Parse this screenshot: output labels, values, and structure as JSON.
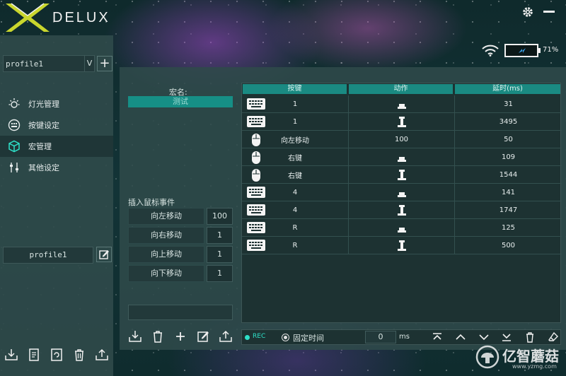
{
  "brand": {
    "logo_text": "DELUX"
  },
  "status": {
    "battery_percent": "71%",
    "battery_level": 0.71
  },
  "sidebar": {
    "profile_select_value": "profile1",
    "profile_select_arrow": "V",
    "items": [
      {
        "label": "灯光管理",
        "icon": "sun-icon",
        "active": false
      },
      {
        "label": "按键设定",
        "icon": "keypad-icon",
        "active": false
      },
      {
        "label": "宏管理",
        "icon": "cube-icon",
        "active": true
      },
      {
        "label": "其他设定",
        "icon": "sliders-icon",
        "active": false
      }
    ],
    "profile_name": "profile1"
  },
  "macro": {
    "name_label": "宏名:",
    "name_value": "测试",
    "insert_title": "插入鼠标事件",
    "moves": [
      {
        "label": "向左移动",
        "value": "100"
      },
      {
        "label": "向右移动",
        "value": "1"
      },
      {
        "label": "向上移动",
        "value": "1"
      },
      {
        "label": "向下移动",
        "value": "1"
      }
    ]
  },
  "table": {
    "headers": [
      "按键",
      "动作",
      "延时(ms)"
    ],
    "rows": [
      {
        "device": "keyboard",
        "key": "1",
        "action": "press",
        "delay": "31"
      },
      {
        "device": "keyboard",
        "key": "1",
        "action": "release",
        "delay": "3495"
      },
      {
        "device": "mouse",
        "key": "向左移动",
        "action": "100",
        "delay": "50"
      },
      {
        "device": "mouse",
        "key": "右键",
        "action": "press",
        "delay": "109"
      },
      {
        "device": "mouse",
        "key": "右键",
        "action": "release",
        "delay": "1544"
      },
      {
        "device": "keyboard",
        "key": "4",
        "action": "press",
        "delay": "141"
      },
      {
        "device": "keyboard",
        "key": "4",
        "action": "release",
        "delay": "1747"
      },
      {
        "device": "keyboard",
        "key": "R",
        "action": "press",
        "delay": "125"
      },
      {
        "device": "keyboard",
        "key": "R",
        "action": "release",
        "delay": "500"
      }
    ]
  },
  "recording": {
    "rec_label": "REC",
    "fixed_time_label": "固定时间",
    "ms_value": "0",
    "ms_unit": "ms"
  },
  "watermark": {
    "text": "亿智蘑菇",
    "sub": "www.yzmg.com"
  },
  "colors": {
    "accent": "#1a8a82",
    "rec": "#2ee0c8",
    "panel": "#2f4a4a"
  }
}
